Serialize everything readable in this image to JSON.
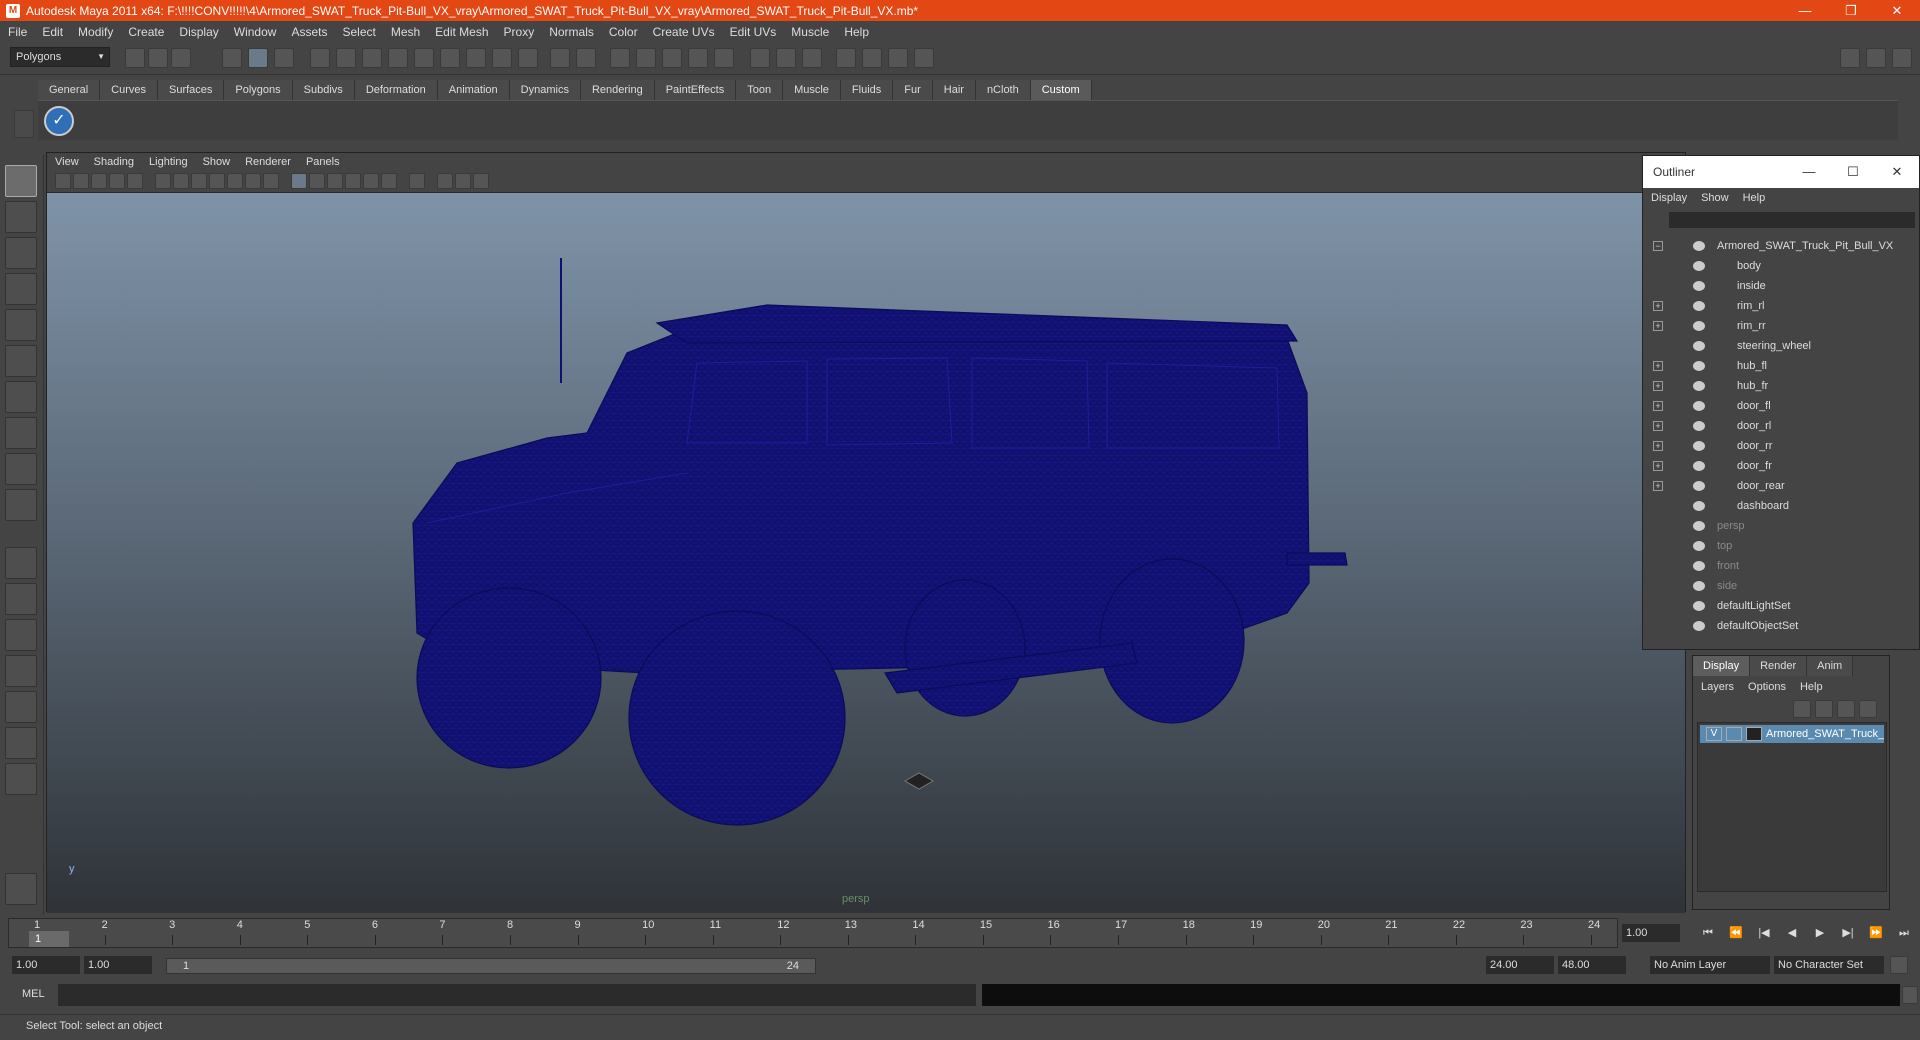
{
  "window": {
    "title": "Autodesk Maya 2011 x64: F:\\!!!!CONV!!!!!\\4\\Armored_SWAT_Truck_Pit-Bull_VX_vray\\Armored_SWAT_Truck_Pit-Bull_VX_vray\\Armored_SWAT_Truck_Pit-Bull_VX.mb*",
    "minimize": "—",
    "maximize": "❐",
    "close": "✕"
  },
  "menubar": [
    "File",
    "Edit",
    "Modify",
    "Create",
    "Display",
    "Window",
    "Assets",
    "Select",
    "Mesh",
    "Edit Mesh",
    "Proxy",
    "Normals",
    "Color",
    "Create UVs",
    "Edit UVs",
    "Muscle",
    "Help"
  ],
  "statusline": {
    "mode": "Polygons"
  },
  "shelf": {
    "tabs": [
      "General",
      "Curves",
      "Surfaces",
      "Polygons",
      "Subdivs",
      "Deformation",
      "Animation",
      "Dynamics",
      "Rendering",
      "PaintEffects",
      "Toon",
      "Muscle",
      "Fluids",
      "Fur",
      "Hair",
      "nCloth",
      "Custom"
    ],
    "active_tab": "Custom"
  },
  "viewport": {
    "menu": [
      "View",
      "Shading",
      "Lighting",
      "Show",
      "Renderer",
      "Panels"
    ],
    "camera_label": "persp",
    "axis_label": "y",
    "wire_color": "#10106e"
  },
  "outliner": {
    "title": "Outliner",
    "win_min": "—",
    "win_max": "☐",
    "win_close": "✕",
    "menu": [
      "Display",
      "Show",
      "Help"
    ],
    "items": [
      {
        "label": "Armored_SWAT_Truck_Pit_Bull_VX",
        "expand": "−",
        "indent": 0
      },
      {
        "label": "body",
        "expand": "",
        "indent": 1
      },
      {
        "label": "inside",
        "expand": "",
        "indent": 1
      },
      {
        "label": "rim_rl",
        "expand": "+",
        "indent": 1
      },
      {
        "label": "rim_rr",
        "expand": "+",
        "indent": 1
      },
      {
        "label": "steering_wheel",
        "expand": "",
        "indent": 1
      },
      {
        "label": "hub_fl",
        "expand": "+",
        "indent": 1
      },
      {
        "label": "hub_fr",
        "expand": "+",
        "indent": 1
      },
      {
        "label": "door_fl",
        "expand": "+",
        "indent": 1
      },
      {
        "label": "door_rl",
        "expand": "+",
        "indent": 1
      },
      {
        "label": "door_rr",
        "expand": "+",
        "indent": 1
      },
      {
        "label": "door_fr",
        "expand": "+",
        "indent": 1
      },
      {
        "label": "door_rear",
        "expand": "+",
        "indent": 1
      },
      {
        "label": "dashboard",
        "expand": "",
        "indent": 1
      },
      {
        "label": "persp",
        "expand": "",
        "indent": 0,
        "dim": true
      },
      {
        "label": "top",
        "expand": "",
        "indent": 0,
        "dim": true
      },
      {
        "label": "front",
        "expand": "",
        "indent": 0,
        "dim": true
      },
      {
        "label": "side",
        "expand": "",
        "indent": 0,
        "dim": true
      },
      {
        "label": "defaultLightSet",
        "expand": "",
        "indent": 0
      },
      {
        "label": "defaultObjectSet",
        "expand": "",
        "indent": 0
      }
    ]
  },
  "layers": {
    "tabs": [
      "Display",
      "Render",
      "Anim"
    ],
    "active_tab": "Display",
    "menu": [
      "Layers",
      "Options",
      "Help"
    ],
    "layer_name": "Armored_SWAT_Truck_Pit_Bull_VX",
    "visibility": "V"
  },
  "timeline": {
    "ticks": [
      "1",
      "2",
      "3",
      "4",
      "5",
      "6",
      "7",
      "8",
      "9",
      "10",
      "11",
      "12",
      "13",
      "14",
      "15",
      "16",
      "17",
      "18",
      "19",
      "20",
      "21",
      "22",
      "23",
      "24"
    ],
    "current_frame": "1.00",
    "playhead_label": "1",
    "playback": [
      "⏮",
      "⏪",
      "|◀",
      "◀",
      "▶",
      "▶|",
      "⏩",
      "⏭"
    ]
  },
  "range": {
    "start": "1.00",
    "playback_start": "1.00",
    "slider_start": "1",
    "slider_end": "24",
    "playback_end": "24.00",
    "end": "48.00",
    "anim_layer": "No Anim Layer",
    "character_set": "No Character Set"
  },
  "command": {
    "label": "MEL"
  },
  "help": {
    "text": "Select Tool: select an object"
  }
}
